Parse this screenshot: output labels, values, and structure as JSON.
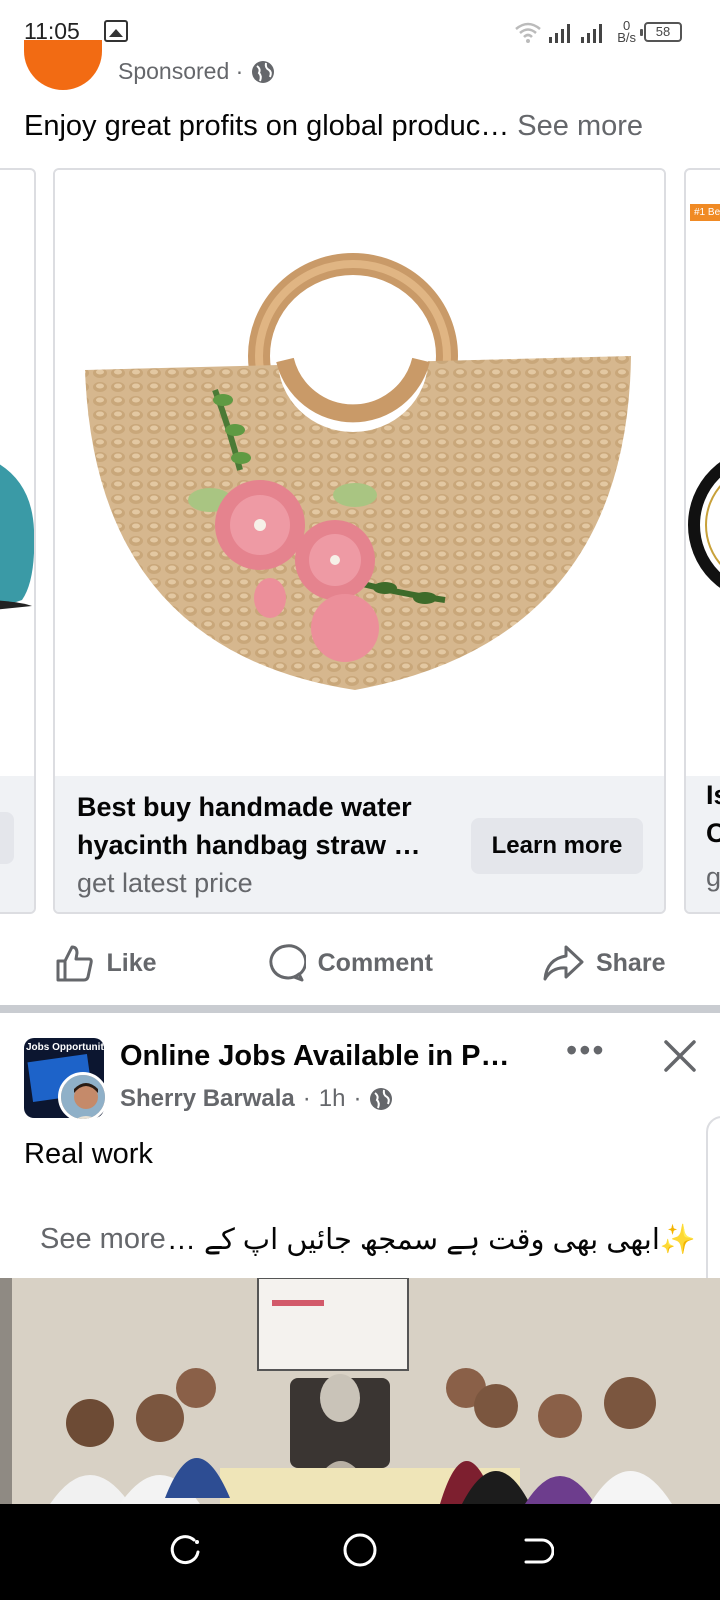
{
  "status_bar": {
    "time": "11:05",
    "net_speed_value": "0",
    "net_speed_unit": "B/s",
    "battery": "58"
  },
  "ad_post": {
    "sponsored_label": "Sponsored ·",
    "text": "Enjoy great profits on global produc…",
    "see_more": "See more",
    "avatar_color": "#f26b13"
  },
  "carousel": {
    "main_card": {
      "title_line1": "Best buy handmade water",
      "title_line2": "hyacinth handbag straw …",
      "subtitle": "get latest price",
      "cta": "Learn more"
    },
    "right_card": {
      "badge": "#1 Be",
      "title_line1": "Is",
      "title_line2": "C",
      "subtitle": "g"
    }
  },
  "actions": {
    "like": "Like",
    "comment": "Comment",
    "share": "Share",
    "like_icon": "thumbs-up-icon",
    "comment_icon": "comment-bubble-icon",
    "share_icon": "share-arrow-icon"
  },
  "job_post": {
    "page_avatar_label": "Jobs Opportunity",
    "title": "Online Jobs Available in P…",
    "author": "Sherry Barwala",
    "time": "1h",
    "body": "Real work",
    "urdu_text": "✨ابھی بھی وقت ہے سمجھ جائیں اپ کے …",
    "see_more": "See more"
  },
  "colors": {
    "secondary_text": "#65676b",
    "footer_bg": "#f0f2f5",
    "button_bg": "#e4e6eb"
  }
}
